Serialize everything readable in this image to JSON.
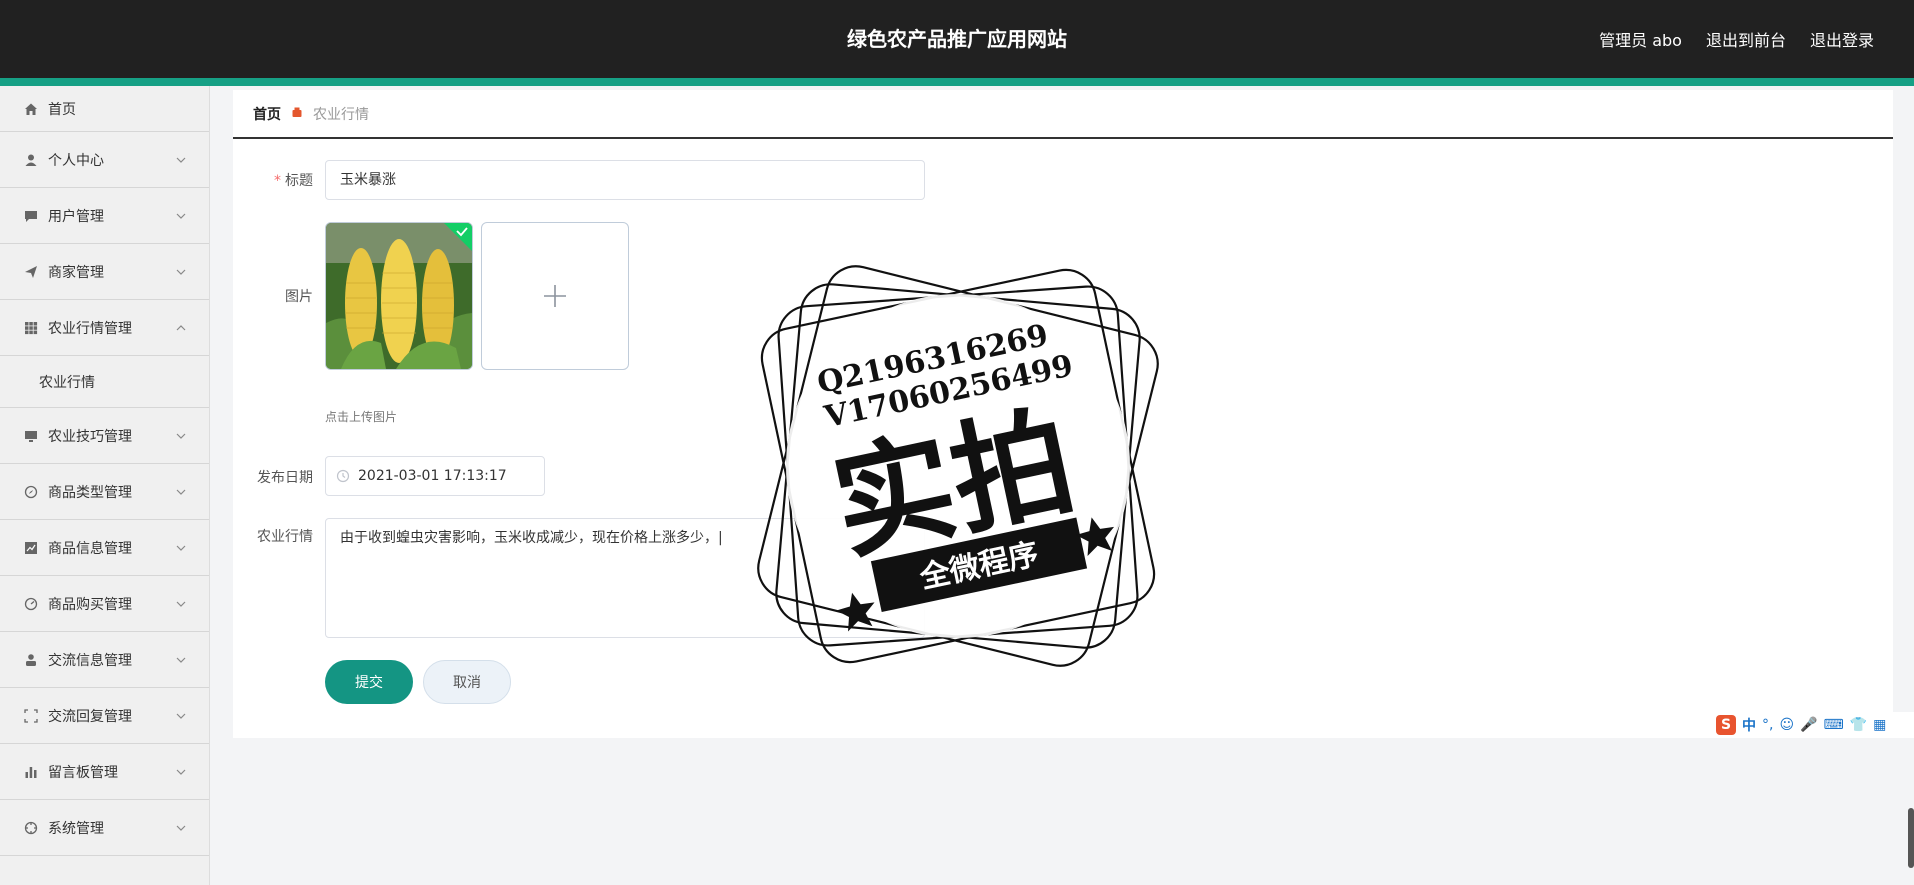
{
  "header": {
    "title": "绿色农产品推广应用网站",
    "user_label": "管理员 abo",
    "front_link": "退出到前台",
    "logout_link": "退出登录"
  },
  "sidebar": {
    "items": [
      {
        "label": "首页"
      },
      {
        "label": "个人中心"
      },
      {
        "label": "用户管理"
      },
      {
        "label": "商家管理"
      },
      {
        "label": "农业行情管理"
      },
      {
        "label": "农业行情"
      },
      {
        "label": "农业技巧管理"
      },
      {
        "label": "商品类型管理"
      },
      {
        "label": "商品信息管理"
      },
      {
        "label": "商品购买管理"
      },
      {
        "label": "交流信息管理"
      },
      {
        "label": "交流回复管理"
      },
      {
        "label": "留言板管理"
      },
      {
        "label": "系统管理"
      }
    ]
  },
  "breadcrumb": {
    "home": "首页",
    "current": "农业行情"
  },
  "form": {
    "title_label": "标题",
    "title_value": "玉米暴涨",
    "image_label": "图片",
    "upload_hint": "点击上传图片",
    "date_label": "发布日期",
    "date_value": "2021-03-01 17:13:17",
    "content_label": "农业行情",
    "content_value": "由于收到蝗虫灾害影响，玉米收成减少，现在价格上涨多少，|",
    "submit_label": "提交",
    "cancel_label": "取消"
  },
  "watermark": {
    "line1": "Q2196316269",
    "line2": "V17060256499",
    "main": "实拍",
    "banner": "全微程序"
  },
  "ime": {
    "mode": "中"
  },
  "colors": {
    "header_bg": "#212121",
    "accent": "#16a085",
    "submit": "#149583"
  }
}
